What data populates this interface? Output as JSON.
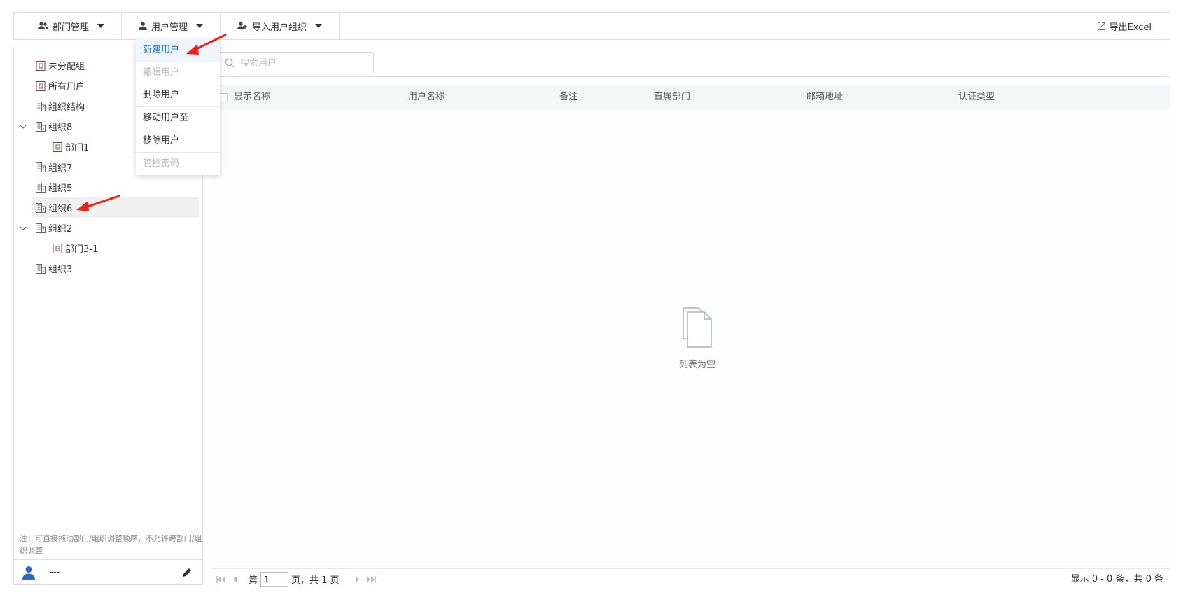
{
  "toolbar": {
    "dept_mgmt": "部门管理",
    "user_mgmt": "用户管理",
    "import_org": "导入用户组织",
    "export_excel": "导出Excel"
  },
  "dropdown": {
    "items": [
      {
        "label": "新建用户",
        "state": "active"
      },
      {
        "label": "编辑用户",
        "state": "disabled"
      },
      {
        "label": "删除用户",
        "state": "normal"
      },
      {
        "label": "移动用户至",
        "state": "normal"
      },
      {
        "label": "移除用户",
        "state": "normal"
      },
      {
        "label": "管控密码",
        "state": "disabled"
      }
    ]
  },
  "tree": {
    "items": [
      {
        "label": "未分配组",
        "icon": "group-icon",
        "level": 0,
        "expandable": false
      },
      {
        "label": "所有用户",
        "icon": "group-icon",
        "level": 0,
        "expandable": false
      },
      {
        "label": "组织结构",
        "icon": "org-icon",
        "level": 0,
        "expandable": false
      },
      {
        "label": "组织8",
        "icon": "org-icon",
        "level": 0,
        "expandable": true,
        "expanded": true
      },
      {
        "label": "部门1",
        "icon": "group-icon",
        "level": 1,
        "expandable": false
      },
      {
        "label": "组织7",
        "icon": "org-icon",
        "level": 0,
        "expandable": false
      },
      {
        "label": "组织5",
        "icon": "org-icon",
        "level": 0,
        "expandable": false
      },
      {
        "label": "组织6",
        "icon": "org-icon",
        "level": 0,
        "expandable": false,
        "selected": true
      },
      {
        "label": "组织2",
        "icon": "org-icon",
        "level": 0,
        "expandable": true,
        "expanded": true
      },
      {
        "label": "部门3-1",
        "icon": "group-icon",
        "level": 1,
        "expandable": false
      },
      {
        "label": "组织3",
        "icon": "org-icon",
        "level": 0,
        "expandable": false
      }
    ]
  },
  "note": "注：可直接拖动部门/组织调整顺序，不允许跨部门/组织调整",
  "footer": {
    "name": "---"
  },
  "search": {
    "placeholder": "搜索用户"
  },
  "table": {
    "columns": [
      "显示名称",
      "用户名称",
      "备注",
      "直属部门",
      "邮箱地址",
      "认证类型"
    ],
    "empty_text": "列表为空"
  },
  "pager": {
    "prefix": "第",
    "page": "1",
    "middle": "页，共 1 页",
    "summary": "显示 0 - 0 条，共 0 条"
  },
  "colors": {
    "accent": "#1c6fc4",
    "annotation_arrow": "#e8231a",
    "header_bg": "#f5f6f8"
  }
}
